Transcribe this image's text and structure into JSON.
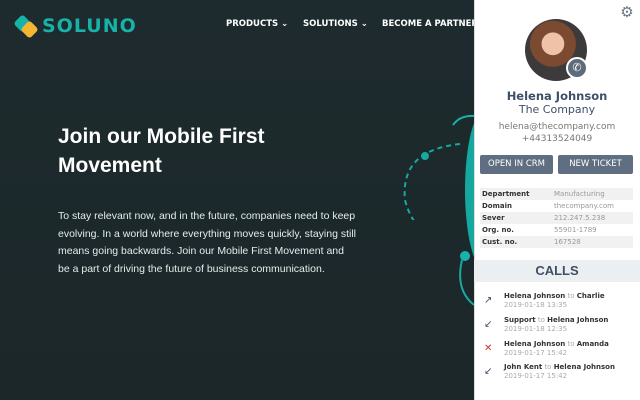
{
  "site": {
    "brand": "SOLUNO",
    "nav": [
      "PRODUCTS",
      "SOLUTIONS",
      "BECOME A PARTNER"
    ],
    "hero_title": "Join our Mobile First Movement",
    "hero_text": "To stay relevant now, and in the future, companies need to keep evolving. In a world where everything moves quickly, staying still means going backwards. Join our Mobile First Movement and be a part of driving the future of business communication.",
    "accent": "#17b3a8"
  },
  "panel": {
    "name": "Helena Johnson",
    "company": "The Company",
    "email": "helena@thecompany.com",
    "phone": "+44313524049",
    "open_crm": "OPEN IN CRM",
    "new_ticket": "NEW TICKET",
    "info": [
      {
        "k": "Department",
        "v": "Manufacturing"
      },
      {
        "k": "Domain",
        "v": "thecompany.com"
      },
      {
        "k": "Sever",
        "v": "212.247.5.238"
      },
      {
        "k": "Org. no.",
        "v": "55901-1789"
      },
      {
        "k": "Cust. no.",
        "v": "167528"
      }
    ],
    "calls_title": "CALLS",
    "to": "to",
    "calls": [
      {
        "icon": "outgoing-arrow",
        "from": "Helena Johnson",
        "to": "Charlie",
        "date": "2019-01-18 13:35"
      },
      {
        "icon": "incoming-arrow",
        "from": "Support",
        "to": "Helena Johnson",
        "date": "2019-01-18 12:35"
      },
      {
        "icon": "missed-x",
        "from": "Helena Johnson",
        "to": "Amanda",
        "date": "2019-01-17 15:42"
      },
      {
        "icon": "incoming-arrow",
        "from": "John Kent",
        "to": "Helena Johnson",
        "date": "2019-01-17 15:42"
      }
    ]
  }
}
